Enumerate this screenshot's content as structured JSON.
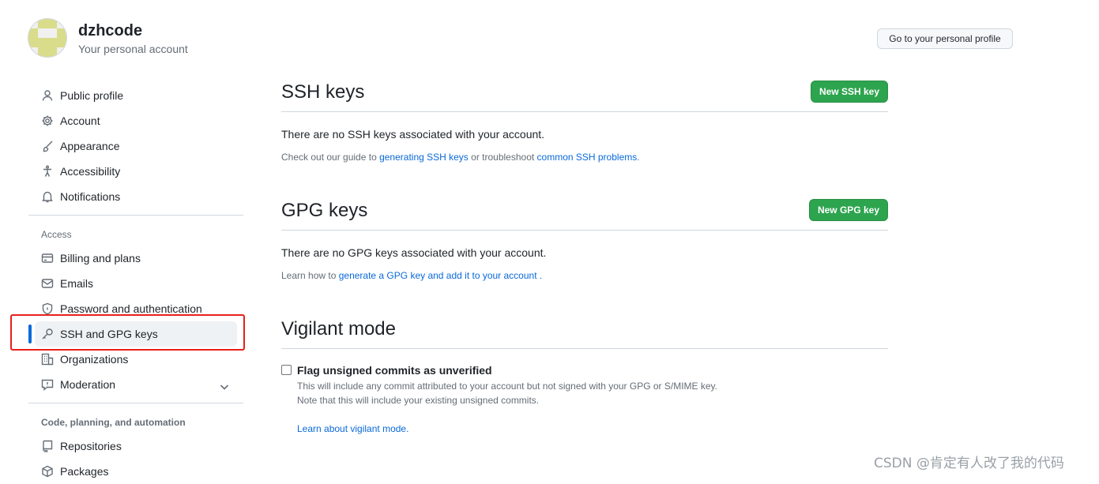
{
  "account": {
    "username": "dzhcode",
    "subtitle": "Your personal account",
    "profile_button": "Go to your personal profile"
  },
  "sidebar": {
    "items_top": [
      {
        "label": "Public profile",
        "icon": "person-icon"
      },
      {
        "label": "Account",
        "icon": "gear-icon"
      },
      {
        "label": "Appearance",
        "icon": "paintbrush-icon"
      },
      {
        "label": "Accessibility",
        "icon": "accessibility-icon"
      },
      {
        "label": "Notifications",
        "icon": "bell-icon"
      }
    ],
    "access_heading": "Access",
    "items_access": [
      {
        "label": "Billing and plans",
        "icon": "credit-card-icon"
      },
      {
        "label": "Emails",
        "icon": "mail-icon"
      },
      {
        "label": "Password and authentication",
        "icon": "shield-lock-icon"
      },
      {
        "label": "SSH and GPG keys",
        "icon": "key-icon",
        "active": true
      },
      {
        "label": "Organizations",
        "icon": "organization-icon"
      },
      {
        "label": "Moderation",
        "icon": "report-icon"
      }
    ],
    "code_heading": "Code, planning, and automation",
    "items_code": [
      {
        "label": "Repositories",
        "icon": "repo-icon"
      },
      {
        "label": "Packages",
        "icon": "package-icon"
      }
    ]
  },
  "ssh": {
    "title": "SSH keys",
    "button": "New SSH key",
    "empty": "There are no SSH keys associated with your account.",
    "guide_prefix": "Check out our guide to ",
    "guide_link1": "generating SSH keys",
    "guide_mid": " or troubleshoot ",
    "guide_link2": "common SSH problems",
    "guide_suffix": "."
  },
  "gpg": {
    "title": "GPG keys",
    "button": "New GPG key",
    "empty": "There are no GPG keys associated with your account.",
    "learn_prefix": "Learn how to ",
    "learn_link": "generate a GPG key and add it to your account",
    "learn_suffix": " ."
  },
  "vigilant": {
    "title": "Vigilant mode",
    "checkbox_label": "Flag unsigned commits as unverified",
    "checked": false,
    "desc1": "This will include any commit attributed to your account but not signed with your GPG or S/MIME key.",
    "desc2": "Note that this will include your existing unsigned commits.",
    "learn_link": "Learn about vigilant mode."
  },
  "watermark": "CSDN @肯定有人改了我的代码",
  "colors": {
    "primary_button": "#2da44e",
    "link": "#0969da",
    "active_indicator": "#0969da",
    "highlight_box": "#e8201c",
    "avatar_fg": "#d9dc8a"
  }
}
